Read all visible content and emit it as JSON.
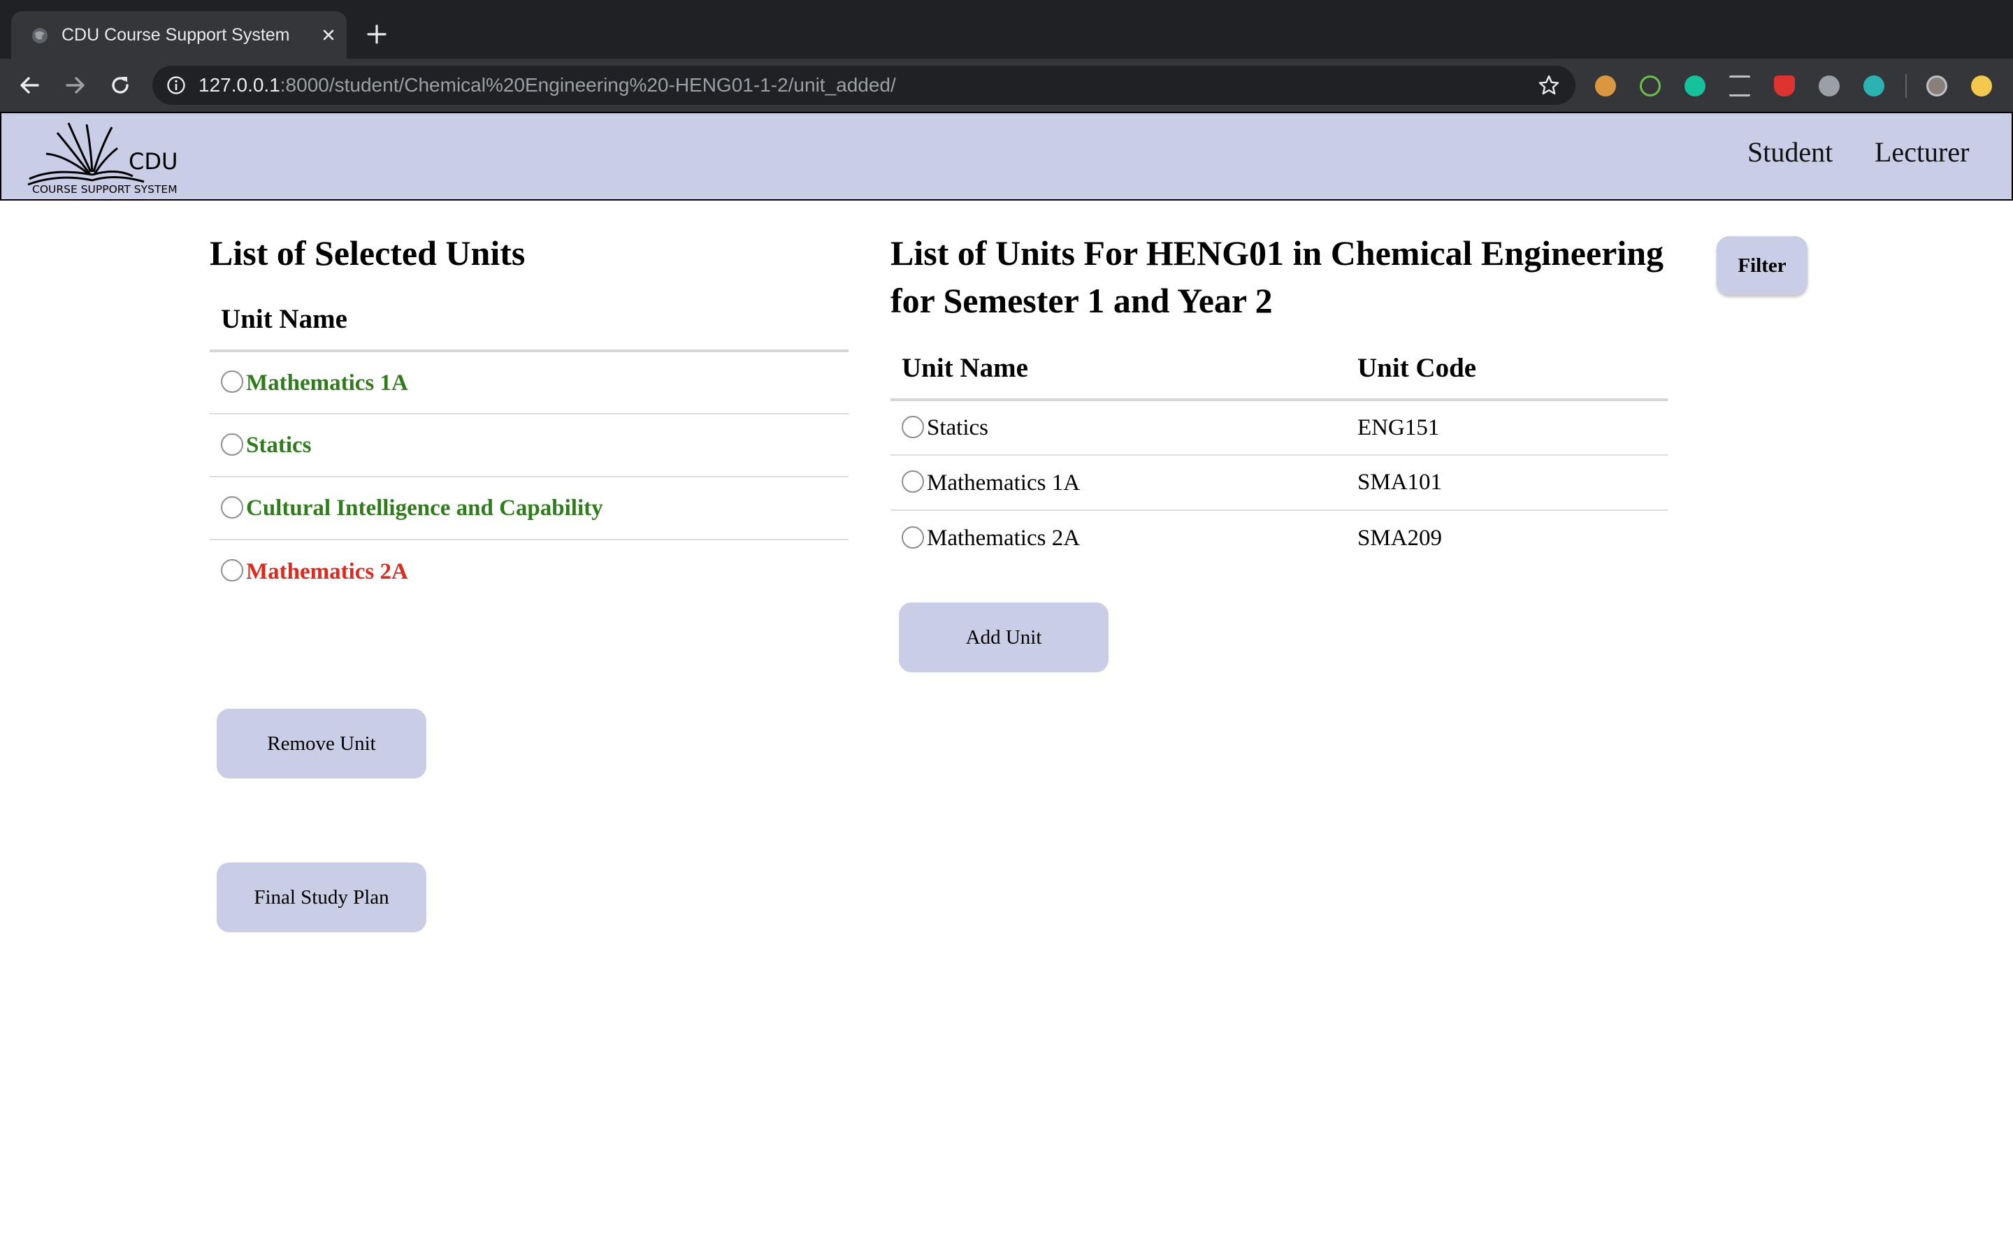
{
  "browser": {
    "tab_title": "CDU Course Support System",
    "url_host": "127.0.0.1",
    "url_rest": ":8000/student/Chemical%20Engineering%20-HENG01-1-2/unit_added/"
  },
  "header": {
    "logo_main": "CDU",
    "logo_sub": "COURSE SUPPORT SYSTEM",
    "nav": {
      "student": "Student",
      "lecturer": "Lecturer"
    }
  },
  "selected": {
    "title": "List of Selected Units",
    "column_header": "Unit Name",
    "units": [
      {
        "name": "Mathematics 1A",
        "status": "ok"
      },
      {
        "name": "Statics",
        "status": "ok"
      },
      {
        "name": "Cultural Intelligence and Capability",
        "status": "ok"
      },
      {
        "name": "Mathematics 2A",
        "status": "error"
      }
    ],
    "remove_label": "Remove Unit",
    "final_label": "Final Study Plan"
  },
  "available": {
    "title": "List of Units For HENG01 in Chemical Engineering for Semester 1 and Year 2",
    "columns": {
      "name": "Unit Name",
      "code": "Unit Code"
    },
    "units": [
      {
        "name": "Statics",
        "code": "ENG151"
      },
      {
        "name": "Mathematics 1A",
        "code": "SMA101"
      },
      {
        "name": "Mathematics 2A",
        "code": "SMA209"
      }
    ],
    "add_label": "Add Unit",
    "filter_label": "Filter"
  },
  "colors": {
    "header_bg": "#c9cde6",
    "ok_text": "#2e7d1a",
    "error_text": "#e0281c",
    "chrome_dark": "#202124",
    "chrome_toolbar": "#35363a"
  }
}
